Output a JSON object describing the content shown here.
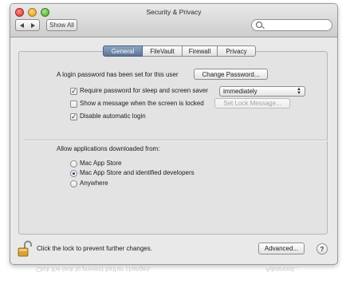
{
  "window": {
    "title": "Security & Privacy",
    "show_all_label": "Show All",
    "search_placeholder": ""
  },
  "tabs": [
    {
      "label": "General",
      "selected": true
    },
    {
      "label": "FileVault",
      "selected": false
    },
    {
      "label": "Firewall",
      "selected": false
    },
    {
      "label": "Privacy",
      "selected": false
    }
  ],
  "general": {
    "login_password_text": "A login password has been set for this user",
    "change_password_label": "Change Password...",
    "require_password": {
      "label": "Require password for sleep and screen saver",
      "checked": true
    },
    "require_password_delay": "immediately",
    "show_message": {
      "label": "Show a message when the screen is locked",
      "checked": false
    },
    "set_lock_message_label": "Set Lock Message...",
    "disable_auto_login": {
      "label": "Disable automatic login",
      "checked": true
    }
  },
  "downloads": {
    "heading": "Allow applications downloaded from:",
    "options": [
      {
        "label": "Mac App Store",
        "selected": false
      },
      {
        "label": "Mac App Store and identified developers",
        "selected": true
      },
      {
        "label": "Anywhere",
        "selected": false
      }
    ]
  },
  "footer": {
    "lock_text": "Click the lock to prevent further changes.",
    "advanced_label": "Advanced...",
    "help_label": "?",
    "reflection_left": "Click the lock to prevent further changes.",
    "reflection_right": "Advanced..."
  },
  "colors": {
    "window_bg": "#e9e9e9",
    "selected_tab": "#5b7397",
    "close_light": "#d6302a",
    "minimize_light": "#d99a1d",
    "zoom_light": "#4aa42e"
  },
  "icons": [
    "close-light-icon",
    "minimize-light-icon",
    "zoom-light-icon",
    "back-arrow-icon",
    "forward-arrow-icon",
    "search-icon",
    "lock-open-icon",
    "help-icon"
  ]
}
